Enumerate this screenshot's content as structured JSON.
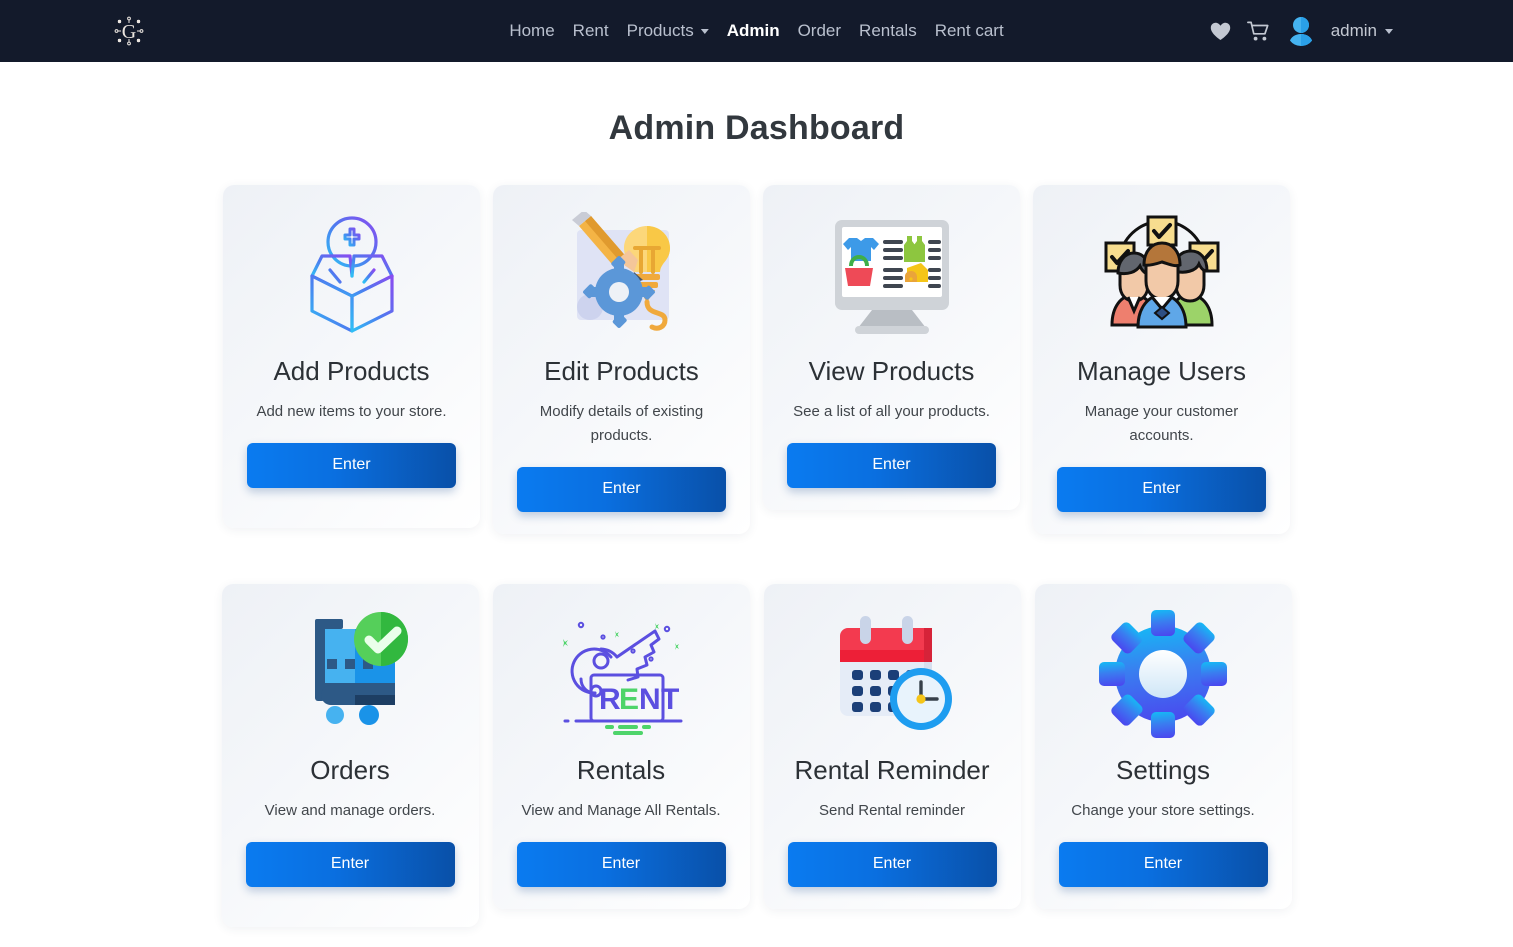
{
  "navbar": {
    "brand_icon": "g-logo-icon",
    "links": [
      {
        "label": "Home",
        "icon": null,
        "active": false
      },
      {
        "label": "Rent",
        "icon": null,
        "active": false
      },
      {
        "label": "Products",
        "icon": "chevron-down-icon",
        "active": false
      },
      {
        "label": "Admin",
        "icon": null,
        "active": true
      },
      {
        "label": "Order",
        "icon": null,
        "active": false
      },
      {
        "label": "Rentals",
        "icon": null,
        "active": false
      },
      {
        "label": "Rent cart",
        "icon": null,
        "active": false
      }
    ],
    "wishlist_icon": "heart-icon",
    "cart_icon": "shopping-cart-icon",
    "avatar_icon": "user-avatar-icon",
    "user_label": "admin",
    "user_caret_icon": "chevron-down-icon",
    "background_color": "#131a2b",
    "active_link_color": "#ffffff",
    "link_color": "#b9c0ce"
  },
  "page": {
    "title": "Admin Dashboard",
    "title_color": "#32383e",
    "background_color": "#ffffff"
  },
  "theme": {
    "button_gradient_start": "#0a7bf0",
    "button_gradient_end": "#0950a8",
    "card_background_start": "#eef1f6",
    "card_background_end": "#ffffff"
  },
  "cards": [
    {
      "id": "add-products",
      "icon": "open-box-with-plus-icon",
      "title": "Add Products",
      "description": "Add new items to your store.",
      "button_label": "Enter"
    },
    {
      "id": "edit-products",
      "icon": "pencil-lightbulb-gear-icon",
      "title": "Edit Products",
      "description": "Modify details of existing products.",
      "button_label": "Enter"
    },
    {
      "id": "view-products",
      "icon": "monitor-product-list-icon",
      "title": "View Products",
      "description": "See a list of all your products.",
      "button_label": "Enter"
    },
    {
      "id": "manage-users",
      "icon": "users-group-checkboxes-icon",
      "title": "Manage Users",
      "description": "Manage your customer accounts.",
      "button_label": "Enter"
    },
    {
      "id": "orders",
      "icon": "shopping-cart-check-icon",
      "title": "Orders",
      "description": "View and manage orders.",
      "button_label": "Enter"
    },
    {
      "id": "rentals",
      "icon": "key-rent-icon",
      "title": "Rentals",
      "description": "View and Manage All Rentals.",
      "button_label": "Enter"
    },
    {
      "id": "rental-reminder",
      "icon": "calendar-clock-icon",
      "title": "Rental Reminder",
      "description": "Send Rental reminder",
      "button_label": "Enter"
    },
    {
      "id": "settings",
      "icon": "gear-icon",
      "title": "Settings",
      "description": "Change your store settings.",
      "button_label": "Enter"
    }
  ]
}
